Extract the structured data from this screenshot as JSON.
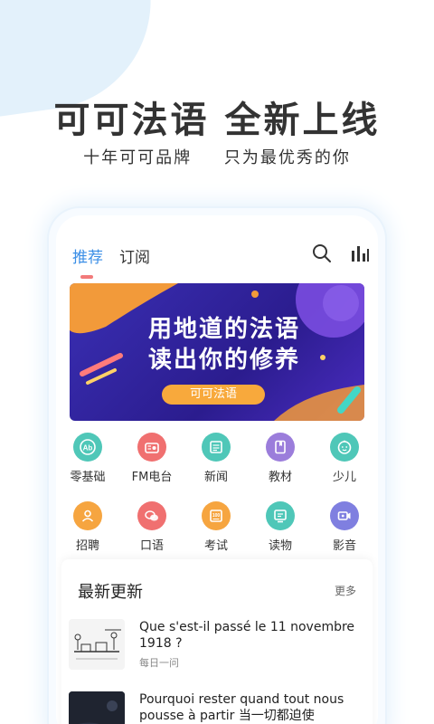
{
  "hero": {
    "headline": "可可法语  全新上线",
    "subheadline_left": "十年可可品牌",
    "subheadline_right": "只为最优秀的你"
  },
  "app": {
    "tabs": [
      {
        "label": "推荐",
        "active": true
      },
      {
        "label": "订阅",
        "active": false
      }
    ],
    "top_icons": [
      "search-icon",
      "chart-bars-icon"
    ],
    "banner": {
      "line1": "用地道的法语",
      "line2": "读出你的修养",
      "pill": "可可法语"
    },
    "categories_row1": [
      {
        "label": "零基础",
        "icon": "ab-icon",
        "color": "#4fc7b8"
      },
      {
        "label": "FM电台",
        "icon": "radio-icon",
        "color": "#f07070"
      },
      {
        "label": "新闻",
        "icon": "news-icon",
        "color": "#4fc7b8"
      },
      {
        "label": "教材",
        "icon": "book-icon",
        "color": "#9b7ddb"
      },
      {
        "label": "少儿",
        "icon": "child-icon",
        "color": "#4fc7b8"
      }
    ],
    "categories_row2": [
      {
        "label": "招聘",
        "icon": "person-icon",
        "color": "#f6a540"
      },
      {
        "label": "口语",
        "icon": "chat-icon",
        "color": "#f07070"
      },
      {
        "label": "考试",
        "icon": "exam-icon",
        "color": "#f6a540"
      },
      {
        "label": "读物",
        "icon": "reader-icon",
        "color": "#4fc7b8"
      },
      {
        "label": "影音",
        "icon": "video-icon",
        "color": "#7f7fe0"
      }
    ],
    "latest": {
      "title": "最新更新",
      "more": "更多",
      "articles": [
        {
          "title": "Que s'est-il passé le 11 novembre 1918 ?",
          "tag": "每日一问"
        },
        {
          "title": "Pourquoi rester quand tout nous pousse à partir 当一切都迫使",
          "tag": ""
        }
      ]
    }
  }
}
